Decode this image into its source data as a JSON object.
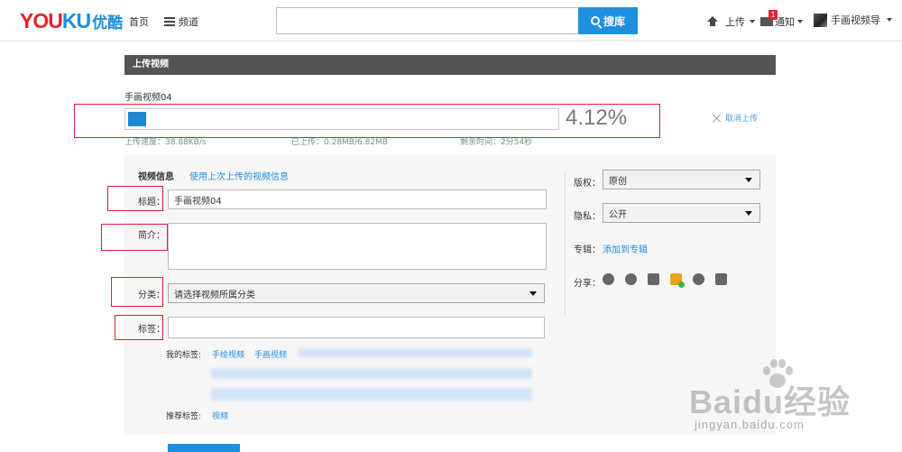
{
  "header": {
    "logo_en_you": "YOU",
    "logo_en_ku": "KU",
    "logo_cn": "优酷",
    "nav_home": "首页",
    "nav_channel": "频道",
    "search_placeholder": "",
    "search_button": "搜库",
    "upload": "上传",
    "notice_badge": "1",
    "notice": "通知",
    "username": "手画视频导"
  },
  "upload": {
    "section_title": "上传视频",
    "video_name": "手画视频04",
    "percent_text": "4.12%",
    "progress_fraction": 0.0412,
    "cancel": "取消上传",
    "speed": "上传速度：38.88KB/s",
    "uploaded": "已上传：0.28MB/6.82MB",
    "remaining": "剩余时间：2分54秒"
  },
  "form": {
    "info_heading": "视频信息",
    "use_last": "使用上次上传的视频信息",
    "title_label": "标题：",
    "title_value": "手画视频04",
    "intro_label": "简介：",
    "intro_value": "",
    "category_label": "分类：",
    "category_value": "请选择视频所属分类",
    "tags_label": "标签：",
    "tags_value": "",
    "my_tags_label": "我的标签:",
    "my_tags": [
      "手绘视频",
      "手画视频"
    ],
    "recommended_label": "推荐标签:",
    "recommended_tags": [
      "视频"
    ]
  },
  "side": {
    "copyright_label": "版权：",
    "copyright_value": "原创",
    "privacy_label": "隐私：",
    "privacy_value": "公开",
    "album_label": "专辑：",
    "album_link": "添加到专辑",
    "share_label": "分享：",
    "share_icons": [
      "renren-icon",
      "weibo-icon",
      "qzone-icon",
      "tencent-star-icon",
      "douban-icon",
      "kaixin-icon"
    ]
  },
  "watermark": {
    "main": "Baidu经验",
    "sub": "jingyan.baidu.com"
  },
  "colors": {
    "accent": "#1f8fe0",
    "logo_red": "#e6202e",
    "section_bar": "#555555",
    "annotation_red": "#e0202e"
  }
}
